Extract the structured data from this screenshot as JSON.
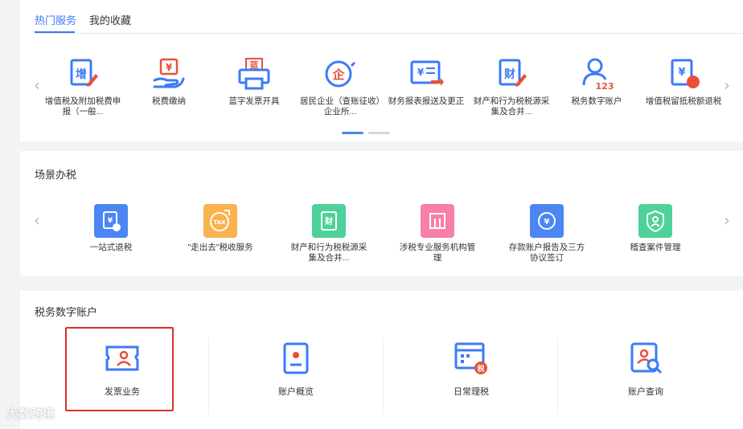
{
  "tabs": [
    {
      "label": "热门服务"
    },
    {
      "label": "我的收藏"
    }
  ],
  "hot_services": [
    {
      "label": "增值税及附加税费申报（一般...",
      "icon": "vat-declare-icon"
    },
    {
      "label": "税费缴纳",
      "icon": "tax-payment-icon"
    },
    {
      "label": "蓝字发票开具",
      "icon": "blue-invoice-printer-icon"
    },
    {
      "label": "居民企业（查账征收）企业所...",
      "icon": "enterprise-tax-icon"
    },
    {
      "label": "财务报表报送及更正",
      "icon": "financial-report-icon"
    },
    {
      "label": "财产和行为税税源采集及合并...",
      "icon": "property-tax-icon"
    },
    {
      "label": "税务数字账户",
      "icon": "digital-account-icon"
    },
    {
      "label": "增值税留抵税额退税",
      "icon": "vat-refund-icon"
    }
  ],
  "scene_title": "场景办税",
  "scene_services": [
    {
      "label": "一站式退税",
      "icon": "one-stop-refund-icon",
      "color": "#4b86f4"
    },
    {
      "label": "\"走出去\"税收服务",
      "icon": "going-abroad-tax-icon",
      "color": "#f9b24e"
    },
    {
      "label": "财产和行为税税源采集及合并...",
      "icon": "property-source-icon",
      "color": "#4fd19a"
    },
    {
      "label": "涉税专业服务机构管理",
      "icon": "agency-management-icon",
      "color": "#f77fa8"
    },
    {
      "label": "存款账户报告及三方协议签订",
      "icon": "deposit-account-icon",
      "color": "#4b86f4"
    },
    {
      "label": "稽查案件管理",
      "icon": "inspection-case-icon",
      "color": "#4fd19a"
    }
  ],
  "account_title": "税务数字账户",
  "account_items": [
    {
      "label": "发票业务",
      "icon": "invoice-business-icon"
    },
    {
      "label": "账户概览",
      "icon": "account-overview-icon"
    },
    {
      "label": "日常理税",
      "icon": "daily-tax-icon"
    },
    {
      "label": "账户查询",
      "icon": "account-query-icon"
    }
  ],
  "icon_texts": {
    "vat": "增",
    "blue": "蓝",
    "enterprise": "企",
    "property": "财",
    "digits": "123",
    "tax": "税",
    "yuan": "¥",
    "tax_badge": "TAX"
  },
  "watermark": "大数跨境",
  "colors": {
    "accent": "#3b7bf6",
    "red": "#e9503b",
    "highlight": "#d9302c"
  }
}
